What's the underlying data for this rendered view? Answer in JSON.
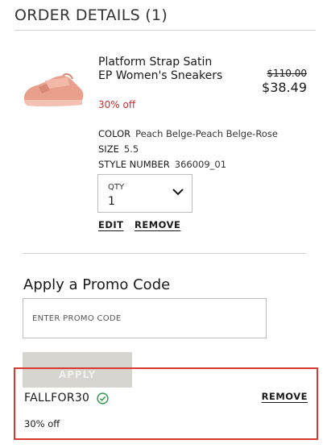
{
  "header": {
    "title": "ORDER DETAILS (1)"
  },
  "item": {
    "image_icon": "pink-sneaker-image",
    "name": "Platform Strap Satin EP Women's Sneakers",
    "discount_label": "30% off",
    "original_price": "$110.00",
    "sale_price": "$38.49",
    "specs": [
      {
        "key": "COLOR",
        "value": "Peach Belge-Peach Belge-Rose"
      },
      {
        "key": "SIZE",
        "value": "5.5"
      },
      {
        "key": "STYLE NUMBER",
        "value": "366009_01"
      }
    ],
    "qty": {
      "label": "QTY",
      "value": "1",
      "icon": "chevron-down-icon"
    },
    "edit_label": "EDIT",
    "remove_label": "REMOVE"
  },
  "promo": {
    "heading": "Apply a Promo Code",
    "placeholder": "ENTER PROMO CODE",
    "value": "",
    "apply_label": "APPLY",
    "applied": {
      "code": "FALLFOR30",
      "status_icon": "check-circle-icon",
      "remove_label": "REMOVE",
      "discount": "30% off"
    }
  },
  "colors": {
    "discount_red": "#cc2e2e",
    "highlight_red": "#d93a30",
    "check_green": "#2e9b4c",
    "apply_disabled_bg": "#d8d4cf"
  }
}
